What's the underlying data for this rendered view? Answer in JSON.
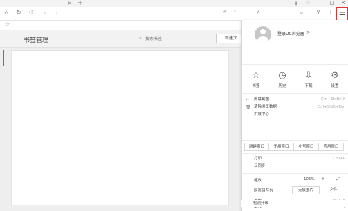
{
  "tabstrip": {
    "close_glyph": "×",
    "new_tab_glyph": "+",
    "window_controls": [
      "ψ",
      "♡",
      "–",
      "□",
      "×"
    ]
  },
  "navbar": {
    "icons": [
      "home-icon",
      "refresh-icon",
      "undo-icon",
      "back-icon",
      "forward-icon"
    ],
    "glyphs": [
      "⌂",
      "↻",
      "↺",
      "‹",
      "›"
    ],
    "address_star": "★",
    "address_dropdown": "▾",
    "address_chevron": "∨",
    "search_glyph": "⌕",
    "cart_glyph": "⊻",
    "more_glyph": "⋮",
    "menu_glyph": "☰"
  },
  "bookmark_bar": {
    "star_glyph": "☆"
  },
  "bookmark_manager": {
    "title": "书签管理",
    "search_placeholder": "搜索书签",
    "new_folder_label": "新建文"
  },
  "uc_menu": {
    "login_text": "登录UC浏览器",
    "login_arrow": ">",
    "quick_actions": [
      {
        "label": "书签",
        "icon": "star-icon",
        "glyph": "☆"
      },
      {
        "label": "历史",
        "icon": "clock-icon",
        "glyph": "◷"
      },
      {
        "label": "下载",
        "icon": "download-icon",
        "glyph": "⇩"
      },
      {
        "label": "设置",
        "icon": "gear-icon",
        "glyph": "⚙"
      }
    ],
    "tools": [
      {
        "label": "屏幕截图",
        "shortcut": "Ctrl+Shift+X",
        "glyph": "✂"
      },
      {
        "label": "清除浏览数据",
        "shortcut": "Ctrl+Shift+Del",
        "glyph": "🗑"
      },
      {
        "label": "扩展中心",
        "shortcut": "",
        "glyph": ""
      }
    ],
    "window_buttons": [
      "新建窗口",
      "无痕窗口",
      "小号窗口",
      "应用窗口"
    ],
    "print_label": "打印",
    "print_shortcut": "Ctrl+P",
    "cloud_sync_label": "云同步",
    "zoom": {
      "label": "缩放",
      "minus": "–",
      "value": "105%",
      "plus": "+",
      "fullscreen_glyph": "⤢"
    },
    "save_label": "网页另存为",
    "no_image_label": "无痕图片",
    "text_label": "文件",
    "find_label": "查找",
    "find_shortcut": "Ctrl+F",
    "tools_label": "工具",
    "submenu_arrow": "▸",
    "update_label": "检测升级"
  }
}
